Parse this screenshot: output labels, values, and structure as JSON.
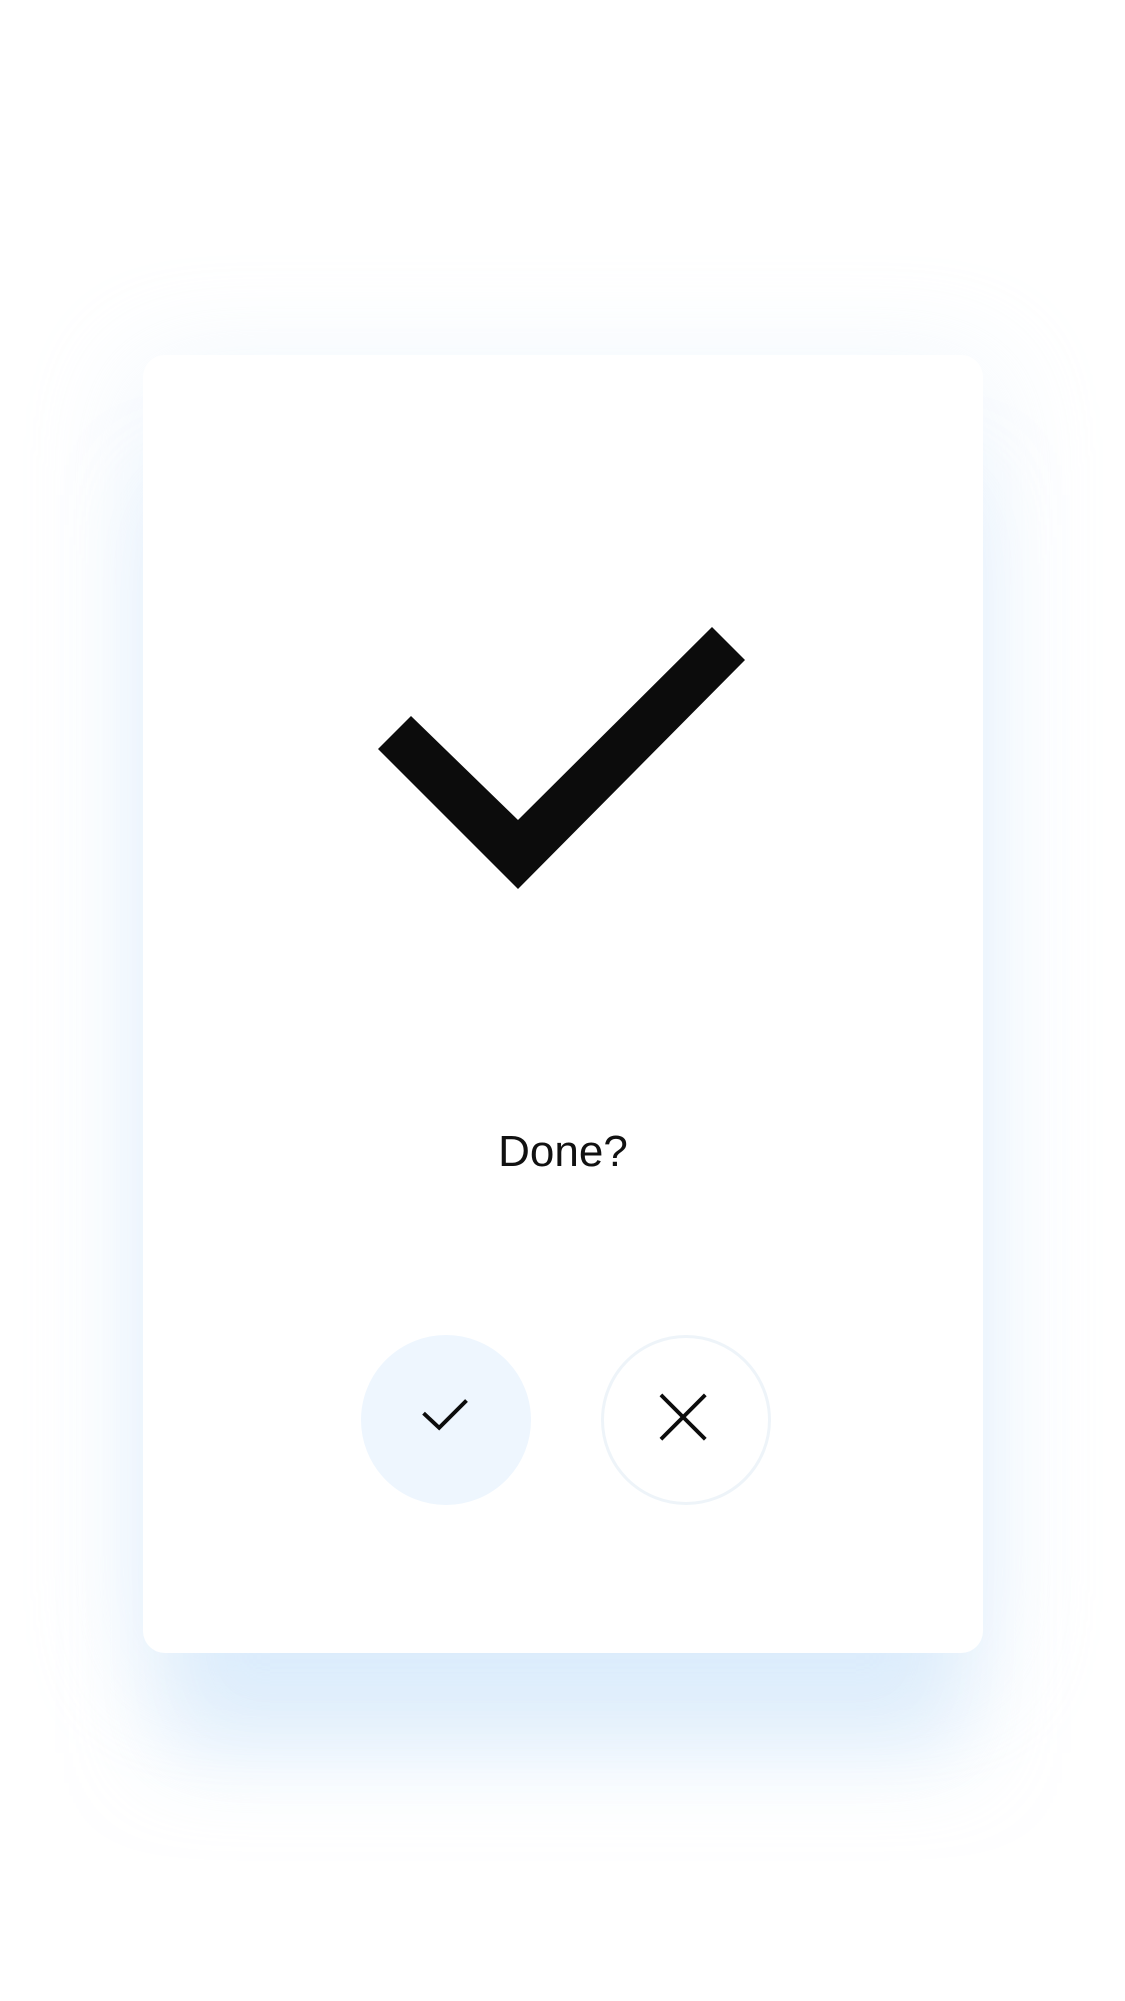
{
  "dialog": {
    "prompt": "Done?",
    "hero_icon": "check-icon",
    "confirm_icon": "check-icon",
    "cancel_icon": "close-icon"
  },
  "colors": {
    "background": "#ffffff",
    "card": "#ffffff",
    "confirm_button_fill": "#eef6fe",
    "cancel_button_border": "#eef4f9",
    "shadow_tint": "#c8e2fa",
    "icon": "#0c0c0c"
  }
}
